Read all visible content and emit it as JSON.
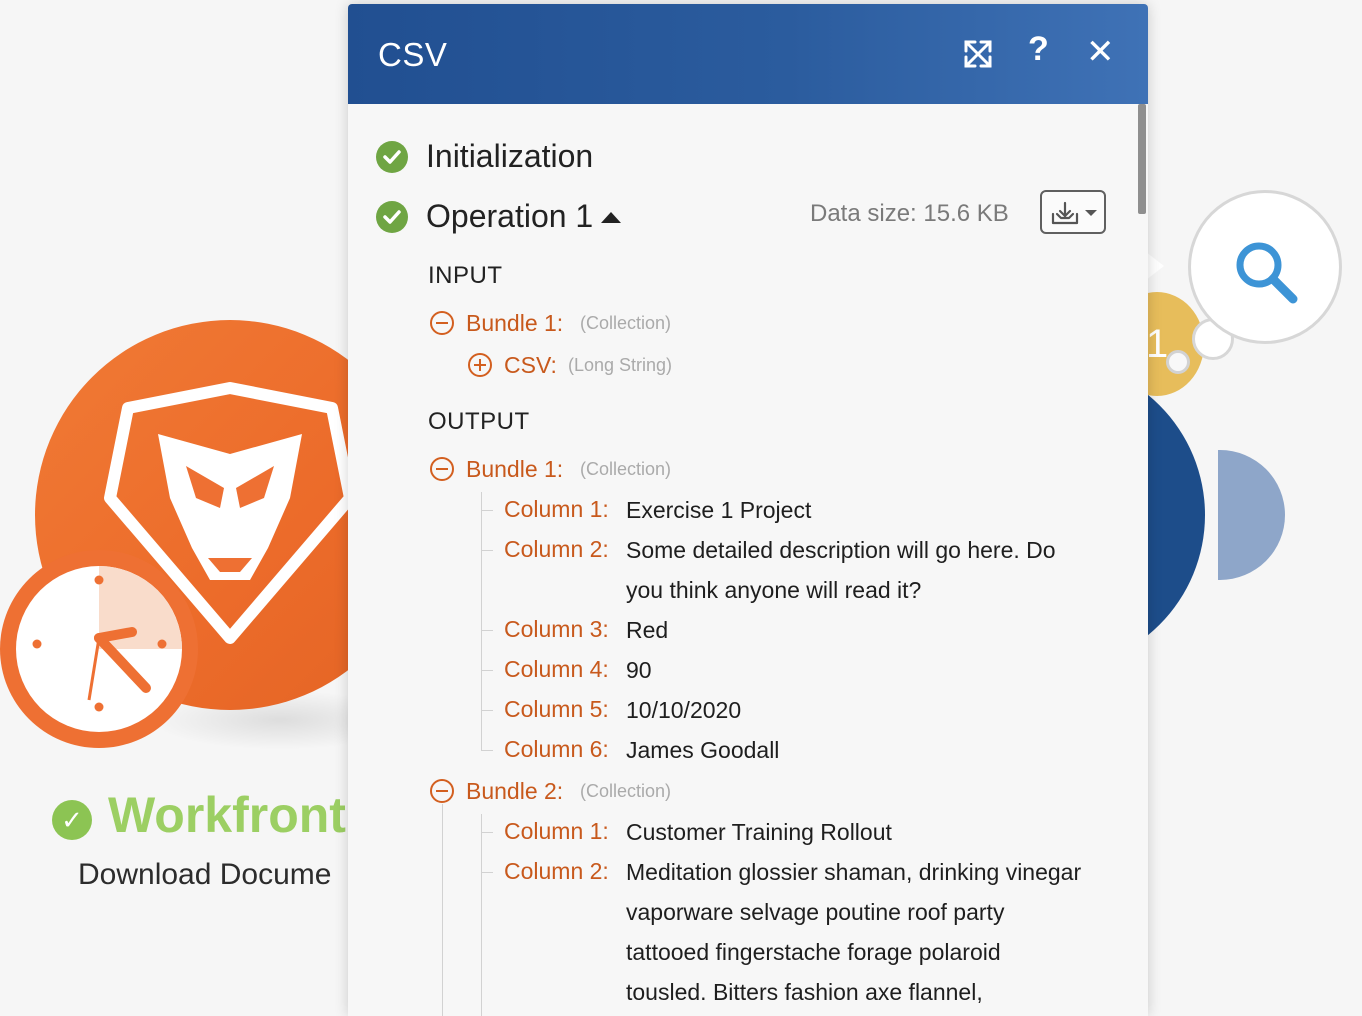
{
  "background": {
    "workfront": {
      "name": "Workfront",
      "action": "Download Docume"
    },
    "csv_badge_number": "1"
  },
  "modal": {
    "title": "CSV",
    "steps": {
      "initialization": "Initialization",
      "operation": "Operation 1"
    },
    "data_size": "Data size: 15.6 KB",
    "input": {
      "label": "INPUT",
      "bundle1": {
        "key": "Bundle 1:",
        "type": "(Collection)",
        "csv_key": "CSV:",
        "csv_type": "(Long String)"
      }
    },
    "output": {
      "label": "OUTPUT",
      "bundle1": {
        "key": "Bundle 1:",
        "type": "(Collection)",
        "columns": [
          {
            "key": "Column 1:",
            "lines": [
              "Exercise 1 Project"
            ]
          },
          {
            "key": "Column 2:",
            "lines": [
              "Some detailed description will go here. Do",
              "you think anyone will read it?"
            ]
          },
          {
            "key": "Column 3:",
            "lines": [
              "Red"
            ]
          },
          {
            "key": "Column 4:",
            "lines": [
              "90"
            ]
          },
          {
            "key": "Column 5:",
            "lines": [
              "10/10/2020"
            ]
          },
          {
            "key": "Column 6:",
            "lines": [
              "James Goodall"
            ]
          }
        ]
      },
      "bundle2": {
        "key": "Bundle 2:",
        "type": "(Collection)",
        "columns": [
          {
            "key": "Column 1:",
            "lines": [
              "Customer Training Rollout"
            ]
          },
          {
            "key": "Column 2:",
            "lines": [
              "Meditation glossier shaman, drinking vinegar",
              "vaporware selvage poutine roof party",
              "tattooed fingerstache forage polaroid",
              "tousled. Bitters fashion axe flannel,"
            ]
          }
        ]
      }
    }
  },
  "icons": {
    "expand": "expand-arrows-icon",
    "help": "question-mark-icon",
    "close": "close-icon",
    "download": "download-icon",
    "search": "magnifier-icon",
    "check": "check-circle-icon",
    "collapse": "minus-circle-icon",
    "expand_item": "plus-circle-icon"
  },
  "colors": {
    "header": "#2b5c9e",
    "success": "#6fa543",
    "key": "#c8591c",
    "workfront": "#ee7033",
    "workfront_title": "#9ccf63"
  }
}
